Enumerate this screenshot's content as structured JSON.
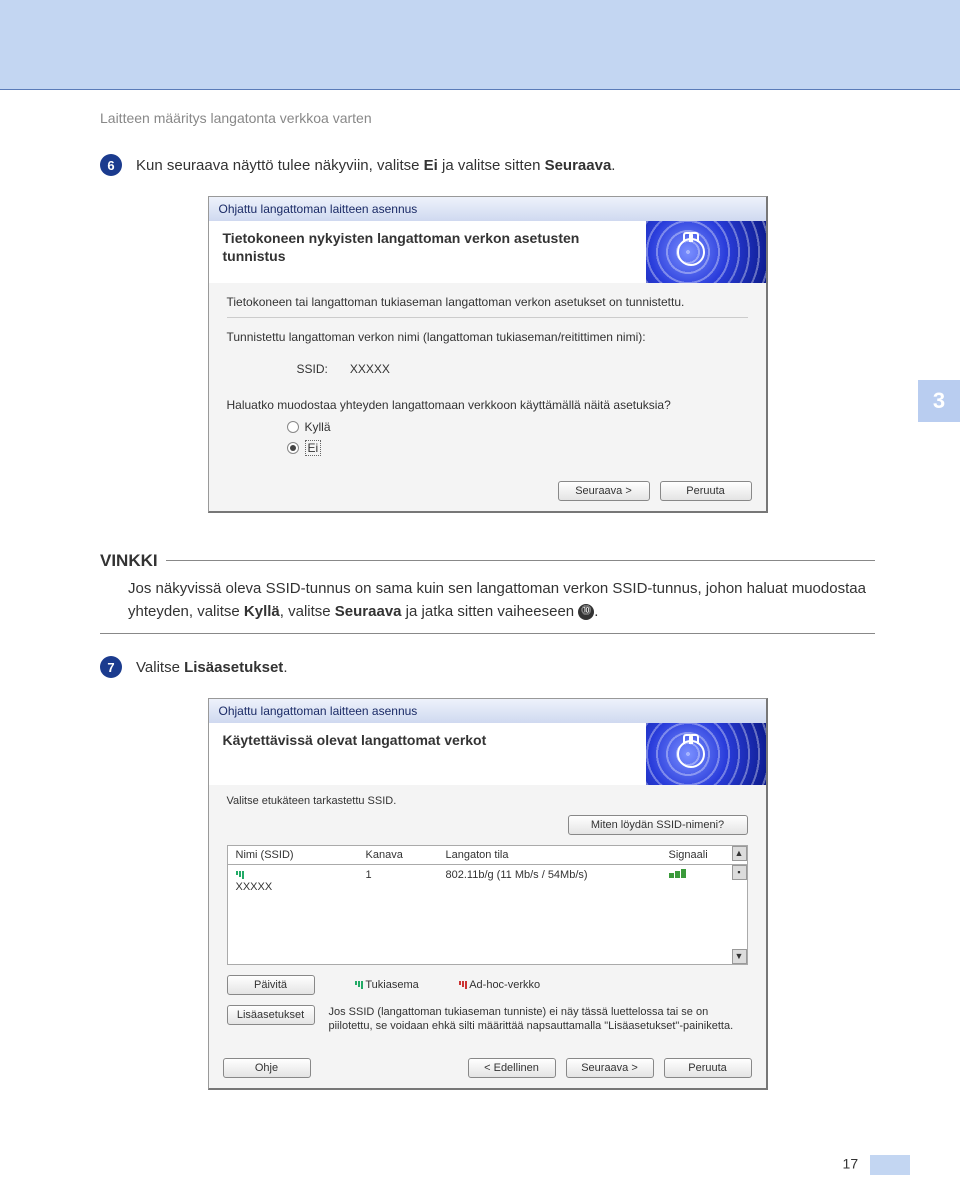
{
  "page": {
    "header": "Laitteen määritys langatonta verkkoa varten",
    "side_tab": "3",
    "page_number": "17"
  },
  "step6": {
    "num": "6",
    "text_pre": "Kun seuraava näyttö tulee näkyviin, valitse ",
    "bold1": "Ei",
    "text_mid": " ja valitse sitten ",
    "bold2": "Seuraava",
    "text_end": "."
  },
  "dialog1": {
    "title": "Ohjattu langattoman laitteen asennus",
    "heading": "Tietokoneen nykyisten langattoman verkon asetusten tunnistus",
    "line1": "Tietokoneen tai langattoman tukiaseman langattoman verkon asetukset on tunnistettu.",
    "line2": "Tunnistettu langattoman verkon nimi (langattoman tukiaseman/reitittimen nimi):",
    "ssid_label": "SSID:",
    "ssid_value": "XXXXX",
    "question": "Haluatko muodostaa yhteyden langattomaan verkkoon käyttämällä näitä asetuksia?",
    "opt_yes": "Kyllä",
    "opt_no": "Ei",
    "btn_next": "Seuraava >",
    "btn_cancel": "Peruuta"
  },
  "vinkki": {
    "title": "VINKKI",
    "body_pre": "Jos näkyvissä oleva SSID-tunnus on sama kuin sen langattoman verkon SSID-tunnus, johon haluat muodostaa yhteyden, valitse ",
    "bold1": "Kyllä",
    "body_mid": ", valitse ",
    "bold2": "Seuraava",
    "body_post": " ja jatka sitten vaiheeseen ",
    "ref": "⓾",
    "body_end": "."
  },
  "step7": {
    "num": "7",
    "text_pre": "Valitse ",
    "bold1": "Lisäasetukset",
    "text_end": "."
  },
  "dialog2": {
    "title": "Ohjattu langattoman laitteen asennus",
    "heading": "Käytettävissä olevat langattomat verkot",
    "subhead": "Valitse etukäteen tarkastettu SSID.",
    "btn_howfind": "Miten löydän SSID-nimeni?",
    "col_name": "Nimi (SSID)",
    "col_channel": "Kanava",
    "col_mode": "Langaton tila",
    "col_signal": "Signaali",
    "row_name": "XXXXX",
    "row_channel": "1",
    "row_mode": "802.11b/g (11 Mb/s / 54Mb/s)",
    "btn_refresh": "Päivitä",
    "legend_ap": "Tukiasema",
    "legend_adhoc": "Ad-hoc-verkko",
    "btn_advanced": "Lisäasetukset",
    "info_text": "Jos SSID (langattoman tukiaseman tunniste) ei näy tässä luettelossa tai se on piilotettu, se voidaan ehkä silti määrittää napsauttamalla \"Lisäasetukset\"-painiketta.",
    "btn_help": "Ohje",
    "btn_back": "< Edellinen",
    "btn_next": "Seuraava >",
    "btn_cancel": "Peruuta"
  }
}
